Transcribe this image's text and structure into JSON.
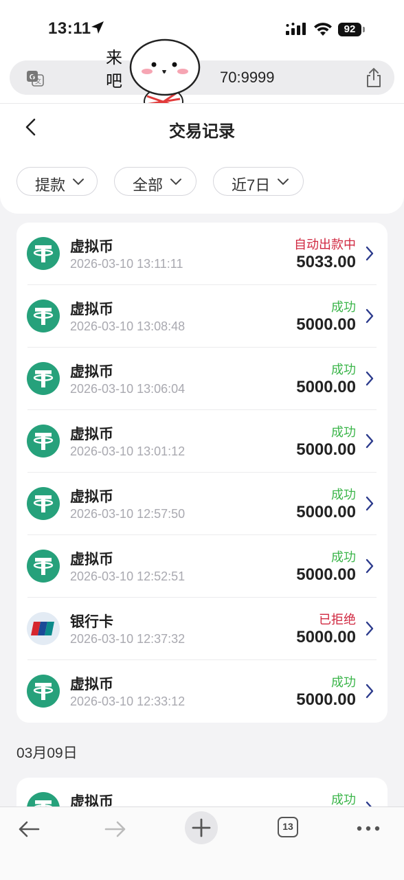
{
  "status_bar": {
    "time": "13:11",
    "battery": "92"
  },
  "url_bar": {
    "url_text": "70:9999"
  },
  "sticker": {
    "text": "来吧"
  },
  "header": {
    "title": "交易记录"
  },
  "filters": [
    {
      "label": "提款"
    },
    {
      "label": "全部"
    },
    {
      "label": "近7日"
    }
  ],
  "transactions": [
    {
      "name": "虚拟币",
      "date": "2026-03-10 13:11:11",
      "status": "自动出款中",
      "amount": "5033.00",
      "icon": "usdt-tether-icon",
      "status_color": "#d0273f"
    },
    {
      "name": "虚拟币",
      "date": "2026-03-10 13:08:48",
      "status": "成功",
      "amount": "5000.00",
      "icon": "usdt-tether-icon",
      "status_color": "#3bb54a"
    },
    {
      "name": "虚拟币",
      "date": "2026-03-10 13:06:04",
      "status": "成功",
      "amount": "5000.00",
      "icon": "usdt-tether-icon",
      "status_color": "#3bb54a"
    },
    {
      "name": "虚拟币",
      "date": "2026-03-10 13:01:12",
      "status": "成功",
      "amount": "5000.00",
      "icon": "usdt-tether-icon",
      "status_color": "#3bb54a"
    },
    {
      "name": "虚拟币",
      "date": "2026-03-10 12:57:50",
      "status": "成功",
      "amount": "5000.00",
      "icon": "usdt-tether-icon",
      "status_color": "#3bb54a"
    },
    {
      "name": "虚拟币",
      "date": "2026-03-10 12:52:51",
      "status": "成功",
      "amount": "5000.00",
      "icon": "usdt-tether-icon",
      "status_color": "#3bb54a"
    },
    {
      "name": "银行卡",
      "date": "2026-03-10 12:37:32",
      "status": "已拒绝",
      "amount": "5000.00",
      "icon": "unionpay-icon",
      "status_color": "#d0273f"
    },
    {
      "name": "虚拟币",
      "date": "2026-03-10 12:33:12",
      "status": "成功",
      "amount": "5000.00",
      "icon": "usdt-tether-icon",
      "status_color": "#3bb54a"
    }
  ],
  "date_group_2": {
    "heading": "03月09日"
  },
  "transactions_2": [
    {
      "name": "虚拟币",
      "status": "成功",
      "icon": "usdt-tether-icon",
      "status_color": "#3bb54a"
    }
  ],
  "toolbar": {
    "tabs_count": "13"
  },
  "colors": {
    "tether_green": "#26a17b",
    "success": "#3bb54a",
    "danger": "#d0273f",
    "chevron": "#2b3a8c"
  }
}
